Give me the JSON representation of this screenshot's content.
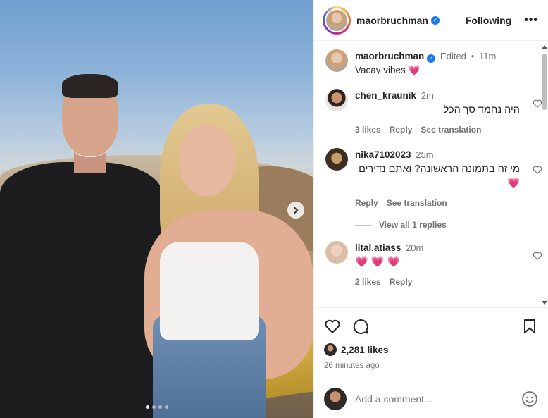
{
  "post": {
    "username": "maorbruchman",
    "follow_label": "Following",
    "more_label": "•••",
    "caption": {
      "username": "maorbruchman",
      "edited": "Edited",
      "dot": "•",
      "time": "11m",
      "text": "Vacay vibes 💗"
    },
    "image_dots": 4
  },
  "comments": [
    {
      "username": "chen_kraunik",
      "time": "2m",
      "text": "היה נחמד סך הכל",
      "likes": "3 likes",
      "reply": "Reply",
      "translate": "See translation"
    },
    {
      "username": "nika7102023",
      "time": "25m",
      "text": "מי זה בתמונה הראשונה? ואתם נדירים 💗",
      "reply": "Reply",
      "translate": "See translation",
      "view_replies": "View all 1 replies"
    },
    {
      "username": "lital.atiass",
      "time": "20m",
      "text": "💗 💗 💗",
      "likes": "2 likes",
      "reply": "Reply"
    }
  ],
  "stats": {
    "likes": "2,281 likes",
    "ago": "26 minutes ago"
  },
  "add_comment": {
    "placeholder": "Add a comment..."
  },
  "icons": {
    "like": "heart-outline-icon",
    "comment": "speech-bubble-icon",
    "save": "bookmark-icon",
    "emoji": "smiley-icon",
    "verified": "verified-badge-icon",
    "next": "chevron-right-icon"
  },
  "colors": {
    "verified": "#1877f2",
    "heart_emoji": "#ed2c5a",
    "muted_text": "#737373"
  }
}
